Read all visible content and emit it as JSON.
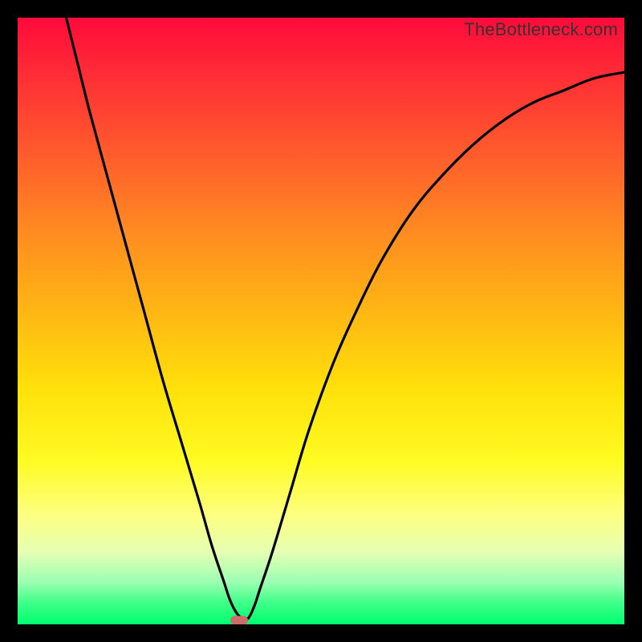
{
  "watermark": "TheBottleneck.com",
  "colors": {
    "curve_stroke": "#000000",
    "marker_fill": "#cc6f6a",
    "frame_bg_top": "#ff0a3a",
    "frame_bg_bottom": "#00ff70",
    "page_bg": "#000000"
  },
  "chart_data": {
    "type": "line",
    "title": "",
    "xlabel": "",
    "ylabel": "",
    "xlim": [
      0,
      100
    ],
    "ylim": [
      0,
      100
    ],
    "grid": false,
    "legend": false,
    "annotations": [
      "TheBottleneck.com"
    ],
    "series": [
      {
        "name": "bottleneck-curve",
        "x": [
          8,
          10,
          12,
          15,
          18,
          21,
          24,
          27,
          30,
          32,
          34,
          35,
          36,
          37,
          38,
          39,
          40,
          42,
          45,
          48,
          52,
          56,
          60,
          65,
          70,
          75,
          80,
          85,
          90,
          95,
          100
        ],
        "y": [
          100,
          92,
          84,
          73,
          62,
          51,
          40,
          30,
          20,
          13,
          7,
          4,
          2,
          1,
          1,
          3,
          6,
          12,
          22,
          32,
          43,
          52,
          60,
          68,
          74,
          79,
          83,
          86,
          88,
          90,
          91
        ]
      }
    ],
    "marker": {
      "x": 36.5,
      "y": 0.7
    }
  }
}
